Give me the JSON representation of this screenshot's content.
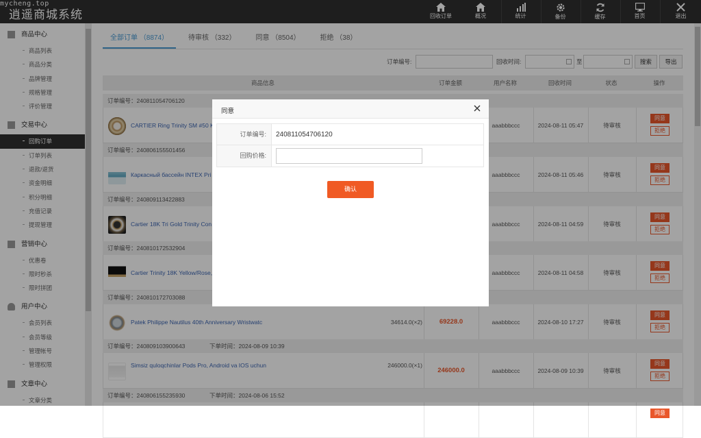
{
  "app": {
    "title": "逍遥商城系统",
    "watermark": "mycheng.top"
  },
  "topnav": [
    {
      "label": "回收订单",
      "icon": "home-icon"
    },
    {
      "label": "概况",
      "icon": "home-icon"
    },
    {
      "label": "统计",
      "icon": "bar-chart-icon"
    },
    {
      "label": "备份",
      "icon": "gear-icon"
    },
    {
      "label": "缓存",
      "icon": "refresh-icon"
    },
    {
      "label": "首页",
      "icon": "monitor-icon"
    },
    {
      "label": "退出",
      "icon": "close-icon"
    }
  ],
  "sidebar": {
    "sections": [
      {
        "title": "商品中心",
        "items": [
          "商品列表",
          "商品分类",
          "品牌管理",
          "规格管理",
          "评价管理"
        ]
      },
      {
        "title": "交易中心",
        "items": [
          "回购订单",
          "订单列表",
          "退款/退货",
          "资金明细",
          "积分明细",
          "充值记录",
          "提现管理"
        ]
      },
      {
        "title": "营销中心",
        "items": [
          "优惠卷",
          "限时秒杀",
          "限时拼团"
        ]
      },
      {
        "title": "用户中心",
        "items": [
          "会员列表",
          "会员等级",
          "管理帐号",
          "管理权限"
        ]
      },
      {
        "title": "文章中心",
        "items": [
          "文章分类"
        ]
      }
    ],
    "active": "回购订单"
  },
  "tabs": [
    "全部订单 （8874）",
    "待审核 （332）",
    "同意 （8504）",
    "拒绝 （38）"
  ],
  "filters": {
    "order_no_label": "订单编号:",
    "time_label": "回收时间:",
    "to_label": "至",
    "search": "搜索",
    "export": "导出"
  },
  "table": {
    "headers": [
      "商品信息",
      "订单金额",
      "用户名称",
      "回收时间",
      "状态",
      "操作"
    ],
    "orders": [
      {
        "order_no": "订单编号：240811054706120",
        "time_label": "",
        "name": "CARTIER Ring Trinity SM #50 K",
        "price": "",
        "total": "",
        "user": "aaabbbccc",
        "time": "2024-08-11 05:47",
        "status": "待审核"
      },
      {
        "order_no": "订单编号：240806155501456",
        "time_label": "",
        "name": "Каркасный бассейн INTEX Pri",
        "price": "",
        "total": "",
        "user": "aaabbbccc",
        "time": "2024-08-11 05:46",
        "status": "待审核"
      },
      {
        "order_no": "订单编号：240809113422883",
        "time_label": "",
        "name": "Cartier 18K Tri Gold Trinity Con",
        "price": "",
        "total": "",
        "user": "aaabbbccc",
        "time": "2024-08-11 04:59",
        "status": "待审核"
      },
      {
        "order_no": "订单编号：240810172532904",
        "time_label": "",
        "name": "Cartier Trinity 18K Yellow/Rose,",
        "price": "",
        "total": "",
        "user": "aaabbbccc",
        "time": "2024-08-11 04:58",
        "status": "待审核"
      },
      {
        "order_no": "订单编号：240810172703088",
        "time_label": "",
        "name": "Patek Philippe Nautilus 40th Anniversary Wristwatc",
        "price": "34614.0(×2)",
        "total": "69228.0",
        "user": "aaabbbccc",
        "time": "2024-08-10 17:27",
        "status": "待审核"
      },
      {
        "order_no": "订单编号：240809103900643",
        "time_label": "下单时间：2024-08-09 10:39",
        "name": "Simsiz quloqchinlar Pods Pro, Android va IOS uchun",
        "price": "246000.0(×1)",
        "total": "246000.0",
        "user": "aaabbbccc",
        "time": "2024-08-09 10:39",
        "status": "待审核"
      },
      {
        "order_no": "订单编号：240806155235930",
        "time_label": "下单时间：2024-08-06 15:52",
        "name": "",
        "price": "",
        "total": "",
        "user": "",
        "time": "",
        "status": ""
      }
    ],
    "accept_label": "同意",
    "reject_label": "拒绝"
  },
  "modal": {
    "title": "同意",
    "order_no_label": "订单编号:",
    "order_no": "240811054706120",
    "price_label": "回购价格:",
    "price_value": "",
    "confirm": "确认"
  },
  "colors": {
    "topbar": "#2f2f2f",
    "accent": "#4a9bd4",
    "danger": "#e9572b",
    "link": "#3c65b1"
  }
}
